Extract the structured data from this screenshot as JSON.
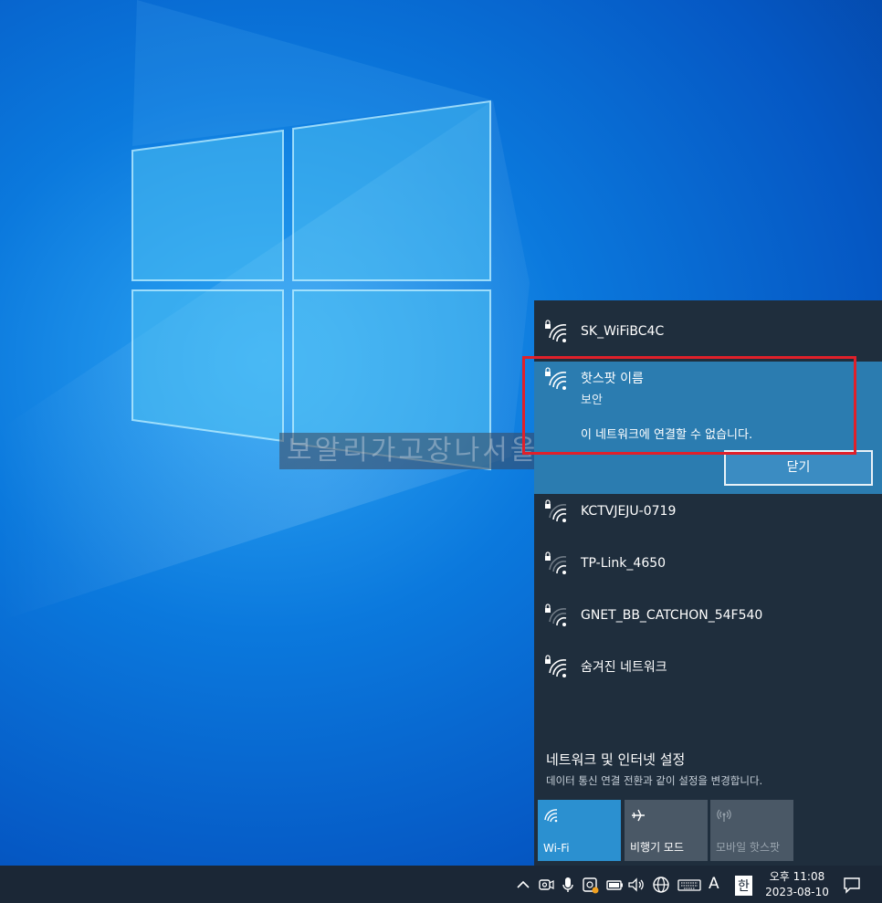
{
  "desktop": {
    "watermark": "보알리가고장나서울지"
  },
  "flyout": {
    "networks": [
      {
        "name": "SK_WiFiBC4C"
      },
      {
        "name": "KCTVJEJU-0719"
      },
      {
        "name": "TP-Link_4650"
      },
      {
        "name": "GNET_BB_CATCHON_54F540"
      },
      {
        "name": "숨겨진 네트워크"
      }
    ],
    "selected_network": {
      "name": "핫스팟 이름",
      "security": "보안",
      "error": "이 네트워크에 연결할 수 없습니다.",
      "close_label": "닫기"
    },
    "settings": {
      "title": "네트워크 및 인터넷 설정",
      "description": "데이터 통신 연결 전환과 같이 설정을 변경합니다."
    },
    "tiles": {
      "wifi": "Wi-Fi",
      "airplane": "비행기 모드",
      "hotspot": "모바일 핫스팟"
    }
  },
  "taskbar": {
    "ime_mode": "A",
    "ime_lang": "한",
    "time": "오후 11:08",
    "date": "2023-08-10"
  },
  "colors": {
    "flyout_bg": "#1f2e3d",
    "selected_bg": "#2b7cb0",
    "accent_tile": "#2b90d0",
    "highlight_border": "#e0202a",
    "taskbar_bg": "#1b2736"
  }
}
